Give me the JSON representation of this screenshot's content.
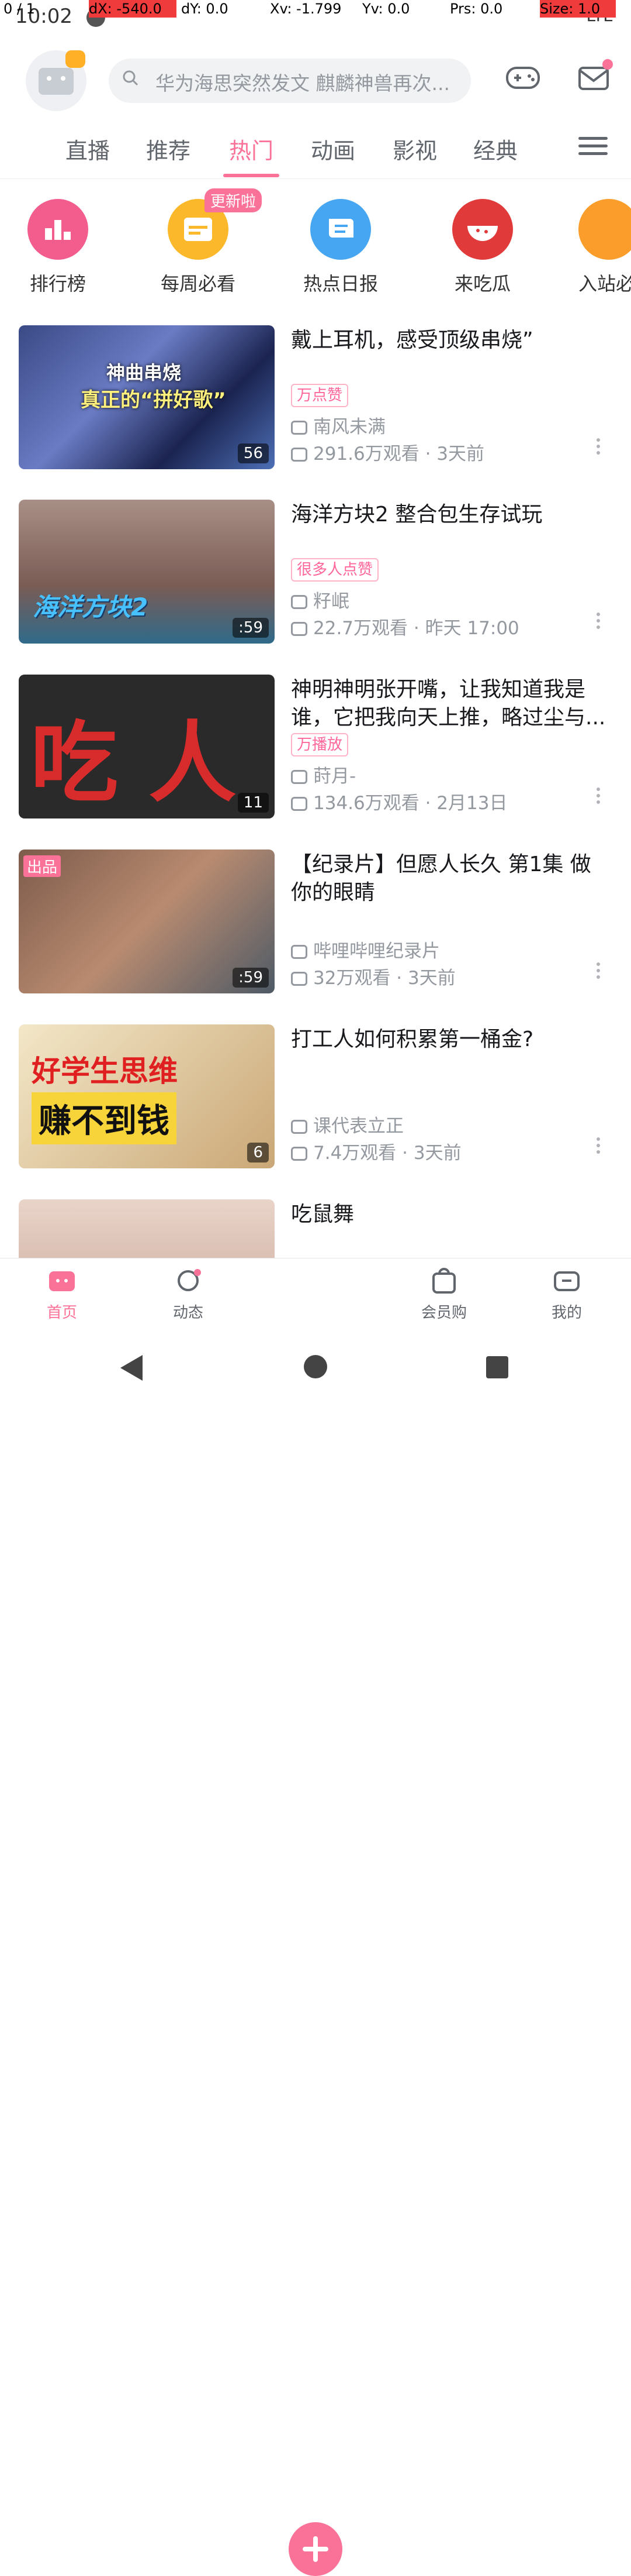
{
  "debug": {
    "pointer": "0 / 1",
    "dx": "dX: -540.0",
    "dy": "dY: 0.0",
    "xv": "Xv: -1.799",
    "yv": "Yv: 0.0",
    "prs": "Prs: 0.0",
    "size": "Size: 1.0"
  },
  "status": {
    "time": "10:02",
    "network": "LTE"
  },
  "header": {
    "search_placeholder": "华为海思突然发文 麒麟神兽再次..."
  },
  "tabs": [
    {
      "label": "直播"
    },
    {
      "label": "推荐"
    },
    {
      "label": "热门",
      "active": true
    },
    {
      "label": "动画"
    },
    {
      "label": "影视"
    },
    {
      "label": "经典"
    }
  ],
  "channels": [
    {
      "label": "排行榜",
      "color": "#f25d8e"
    },
    {
      "label": "每周必看",
      "color": "#fbb82a"
    },
    {
      "label": "热点日报",
      "color": "#46a6f2"
    },
    {
      "label": "来吃瓜",
      "color": "#e03a3a"
    },
    {
      "label": "入站必",
      "color": "#fa9d2a"
    }
  ],
  "new_tag": "更新啦",
  "feed": [
    {
      "title": "戴上耳机，感受顶级串烧”",
      "badge": "万点赞",
      "uploader": "南风未满",
      "meta": "291.6万观看 · 3天前",
      "duration": "56",
      "thumb_caption": "神曲串烧",
      "thumb_caption2": "真正的“拼好歌”"
    },
    {
      "title": "海洋方块2 整合包生存试玩",
      "badge": "很多人点赞",
      "uploader": "籽岷",
      "meta": "22.7万观看 · 昨天 17:00",
      "duration": ":59",
      "thumb_caption": "海洋方块2"
    },
    {
      "title": "神明神明张开嘴，让我知道我是谁，它把我向天上推，略过尘与...",
      "badge": "万播放",
      "uploader": "莳月-",
      "meta": "134.6万观看 · 2月13日",
      "duration": "11",
      "thumb_caption": "吃 人"
    },
    {
      "title": "【纪录片】但愿人长久 第1集 做你的眼睛",
      "badge": "",
      "uploader": "哔哩哔哩纪录片",
      "meta": "32万观看 · 3天前",
      "duration": ":59",
      "thumb_caption": "出品"
    },
    {
      "title": "打工人如何积累第一桶金?",
      "badge": "",
      "uploader": "课代表立正",
      "meta": "7.4万观看 · 3天前",
      "duration": "6",
      "thumb_caption": "好学生思维",
      "thumb_caption2": "赚不到钱"
    },
    {
      "title": "吃鼠舞",
      "badge": "",
      "uploader": "",
      "meta": "",
      "duration": ""
    }
  ],
  "bottom_nav": [
    {
      "label": "首页",
      "active": true
    },
    {
      "label": "动态"
    },
    {
      "label": "发布"
    },
    {
      "label": "会员购"
    },
    {
      "label": "我的"
    }
  ]
}
